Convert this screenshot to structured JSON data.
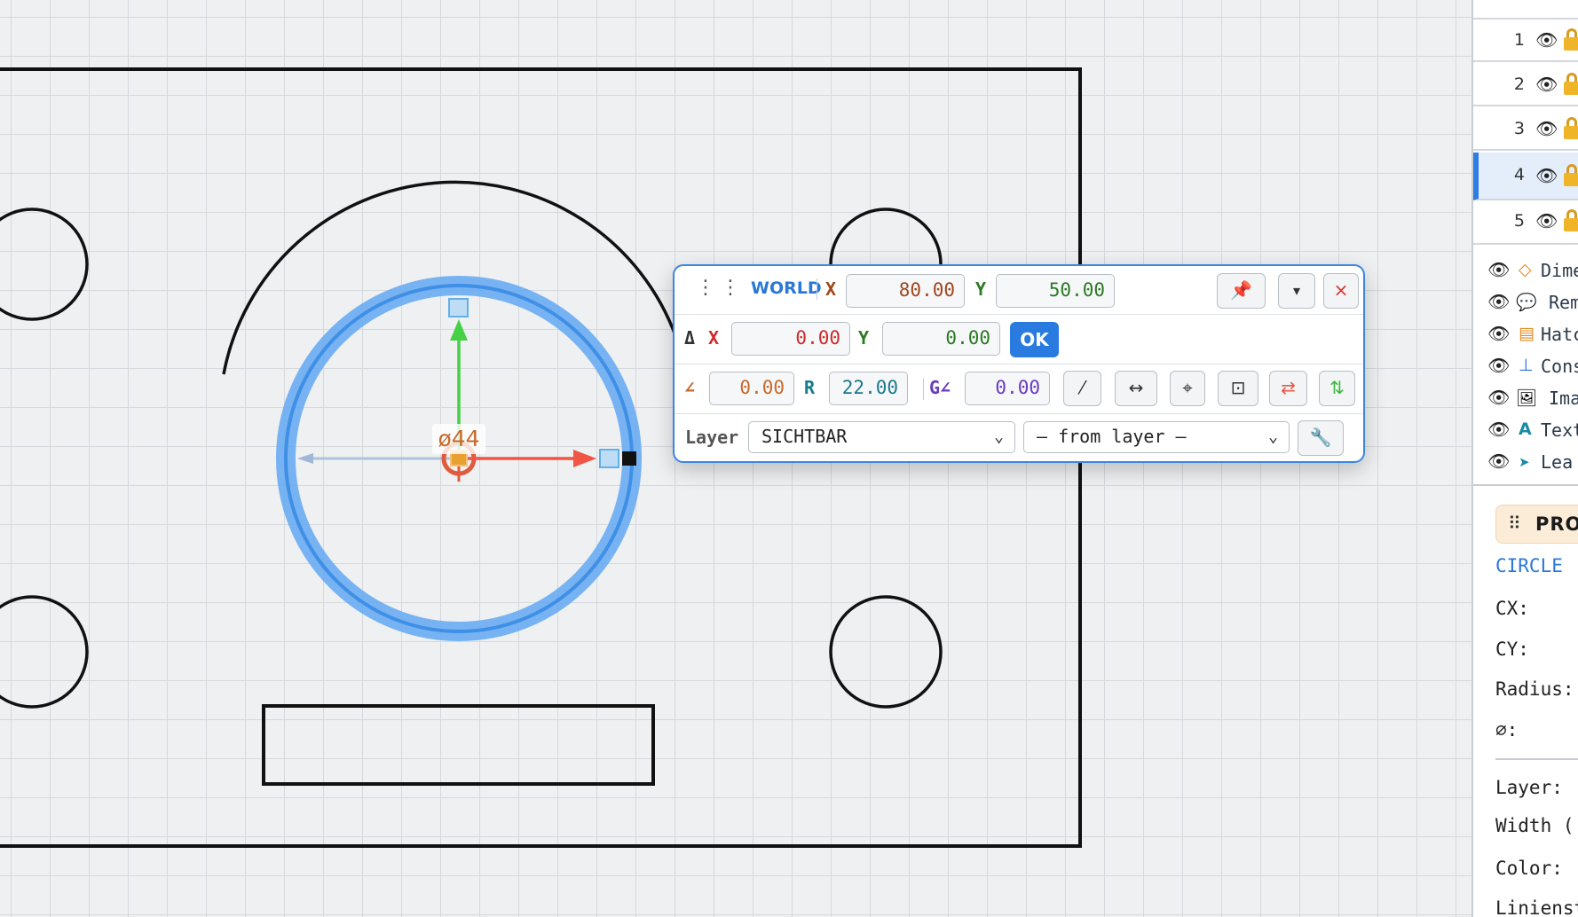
{
  "canvas": {
    "dimension_label": "ø44",
    "colors": {
      "grid": "#d5d9de",
      "selection": "#4a9af0",
      "gizmo_y": "#46d046",
      "gizmo_x": "#f05545"
    }
  },
  "coord_panel": {
    "frame_label": "WORLD",
    "x_label": "X",
    "x_value": "80.00",
    "y_label": "Y",
    "y_value": "50.00",
    "pin_icon": "pin-icon",
    "collapse_label": "▾",
    "close_label": "×",
    "delta_label": "Δ",
    "dx_label": "X",
    "dx_value": "0.00",
    "dy_label": "Y",
    "dy_value": "0.00",
    "ok_label": "OK",
    "angle_label": "∠",
    "angle_value": "0.00",
    "r_label": "R",
    "r_value": "22.00",
    "g_label": "G∠",
    "g_value": "0.00",
    "tool_labels": [
      "⁄",
      "↔",
      "⌖",
      "⊡",
      "⇄",
      "⇅"
    ],
    "layer_label": "Layer",
    "layer_value": "SICHTBAR",
    "linetype_value": "— from layer —",
    "wrench_icon": "wrench-icon"
  },
  "sidebar": {
    "layers": [
      {
        "number": "1",
        "active": false
      },
      {
        "number": "2",
        "active": false
      },
      {
        "number": "3",
        "active": false
      },
      {
        "number": "4",
        "active": true
      },
      {
        "number": "5",
        "active": false
      }
    ],
    "types": [
      {
        "icon": "◇",
        "label": "Dime",
        "color": "#e08a1e"
      },
      {
        "icon": "💬",
        "label": "Rem",
        "color": "#444444"
      },
      {
        "icon": "▤",
        "label": "Hatc",
        "color": "#e08a1e"
      },
      {
        "icon": "⊥",
        "label": "Cons",
        "color": "#2a6fd6"
      },
      {
        "icon": "🖼",
        "label": "Ima",
        "color": "#2a6fd6"
      },
      {
        "icon": "A",
        "label": "Text",
        "color": "#1a8aa8"
      },
      {
        "icon": "➤",
        "label": "Lea",
        "color": "#1a8aa8"
      }
    ],
    "properties": {
      "grip": "⠿",
      "title": "PROP",
      "entity_type": "CIRCLE",
      "cx_label": "CX:",
      "cy_label": "CY:",
      "radius_label": "Radius:",
      "diameter_label": "⌀:",
      "layer_label": "Layer:",
      "width_label": "Width (",
      "color_label": "Color:",
      "linetype_label": "Linienst"
    }
  }
}
